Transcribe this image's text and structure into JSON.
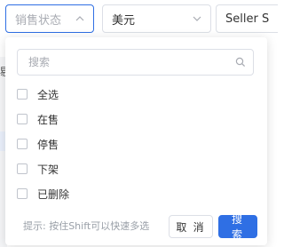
{
  "filters": {
    "status_placeholder": "销售状态",
    "currency_value": "美元",
    "sku_label": "Seller SKU"
  },
  "background": {
    "left_fragment": "剔"
  },
  "dropdown": {
    "search_placeholder": "搜索",
    "options": [
      {
        "label": "全选",
        "checked": false
      },
      {
        "label": "在售",
        "checked": false
      },
      {
        "label": "停售",
        "checked": false
      },
      {
        "label": "下架",
        "checked": false
      },
      {
        "label": "已删除",
        "checked": false
      }
    ],
    "hint": "提示: 按住Shift可以快速多选",
    "cancel_label": "取 消",
    "search_label": "搜 索"
  },
  "colors": {
    "primary": "#2f6fe4",
    "border": "#dcdfe6",
    "placeholder": "#a8abb2"
  },
  "icons": {
    "status_chevron": "chevron-up-icon",
    "currency_chevron": "chevron-down-icon",
    "search": "search-icon"
  }
}
